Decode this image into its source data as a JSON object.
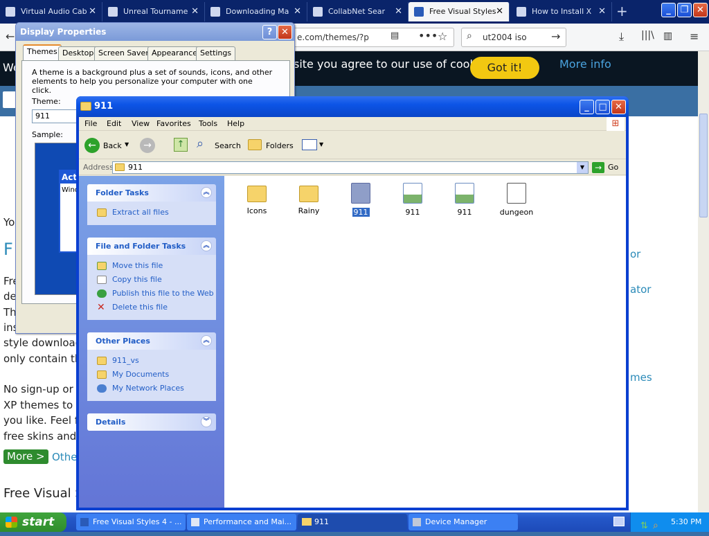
{
  "browser": {
    "tabs": [
      {
        "title": "Virtual Audio Cab"
      },
      {
        "title": "Unreal Tourname"
      },
      {
        "title": "Downloading Ma"
      },
      {
        "title": "CollabNet Sear"
      },
      {
        "title": "Free Visual Styles"
      },
      {
        "title": "How to Install X"
      }
    ],
    "new_tab": "+",
    "url": "e.com/themes/?p",
    "search_value": "ut2004 iso",
    "cookie_text": "site you agree to our use of cookies.",
    "cookie_prefix": "We",
    "gotit_label": "Got it!",
    "moreinfo_label": "More info",
    "page": {
      "you": "Yo",
      "heading_f": "F",
      "fre": "Fre",
      "de": "de",
      "th": "Th",
      "ins": "ins",
      "style_downloads": "style downloads",
      "only_contain": "only contain the",
      "no_signup": "No sign-up or re",
      "xp_themes": "XP themes to c",
      "you_like": "you like. Feel fr",
      "free_skins": "free skins and t",
      "more_btn": "More >",
      "other": "Othe",
      "free_visual": "Free Visual S",
      "right_or": "or",
      "right_ator": "ator",
      "right_mes": "mes"
    }
  },
  "display_properties": {
    "title": "Display Properties",
    "help_btn": "?",
    "close_btn": "✕",
    "tabs": [
      "Themes",
      "Desktop",
      "Screen Saver",
      "Appearance",
      "Settings"
    ],
    "description": "A theme is a background plus a set of sounds, icons, and other elements to help you personalize your computer with one click.",
    "theme_label": "Theme:",
    "theme_value": "911",
    "sample_label": "Sample:",
    "sample_act": "Act",
    "sample_wind": "Wind"
  },
  "explorer": {
    "title": "911",
    "menu": [
      "File",
      "Edit",
      "View",
      "Favorites",
      "Tools",
      "Help"
    ],
    "toolbar": {
      "back": "Back",
      "search": "Search",
      "folders": "Folders"
    },
    "address_label": "Address",
    "address_value": "911",
    "go_label": "Go",
    "folder_tasks": {
      "title": "Folder Tasks",
      "items": [
        "Extract all files"
      ]
    },
    "file_folder_tasks": {
      "title": "File and Folder Tasks",
      "items": [
        "Move this file",
        "Copy this file",
        "Publish this file to the Web",
        "Delete this file"
      ]
    },
    "other_places": {
      "title": "Other Places",
      "items": [
        "911_vs",
        "My Documents",
        "My Network Places"
      ]
    },
    "details": {
      "title": "Details"
    },
    "files": [
      {
        "name": "Icons",
        "icon": "folder-icon"
      },
      {
        "name": "Rainy",
        "icon": "folder-icon"
      },
      {
        "name": "911",
        "icon": "theme-file-icon",
        "selected": true
      },
      {
        "name": "911",
        "icon": "image-file-icon"
      },
      {
        "name": "911",
        "icon": "image-file-icon"
      },
      {
        "name": "dungeon",
        "icon": "document-file-icon"
      }
    ]
  },
  "taskbar": {
    "start_label": "start",
    "tasks": [
      {
        "label": "Free Visual Styles 4 - ..."
      },
      {
        "label": "Performance and Mai..."
      },
      {
        "label": "911",
        "active": true
      },
      {
        "label": "Device Manager"
      }
    ],
    "clock": "5:30 PM"
  },
  "colors": {
    "xp_blue": "#0a46c8",
    "start_green": "#2f8d2c",
    "cookie_button": "#f2c811"
  }
}
